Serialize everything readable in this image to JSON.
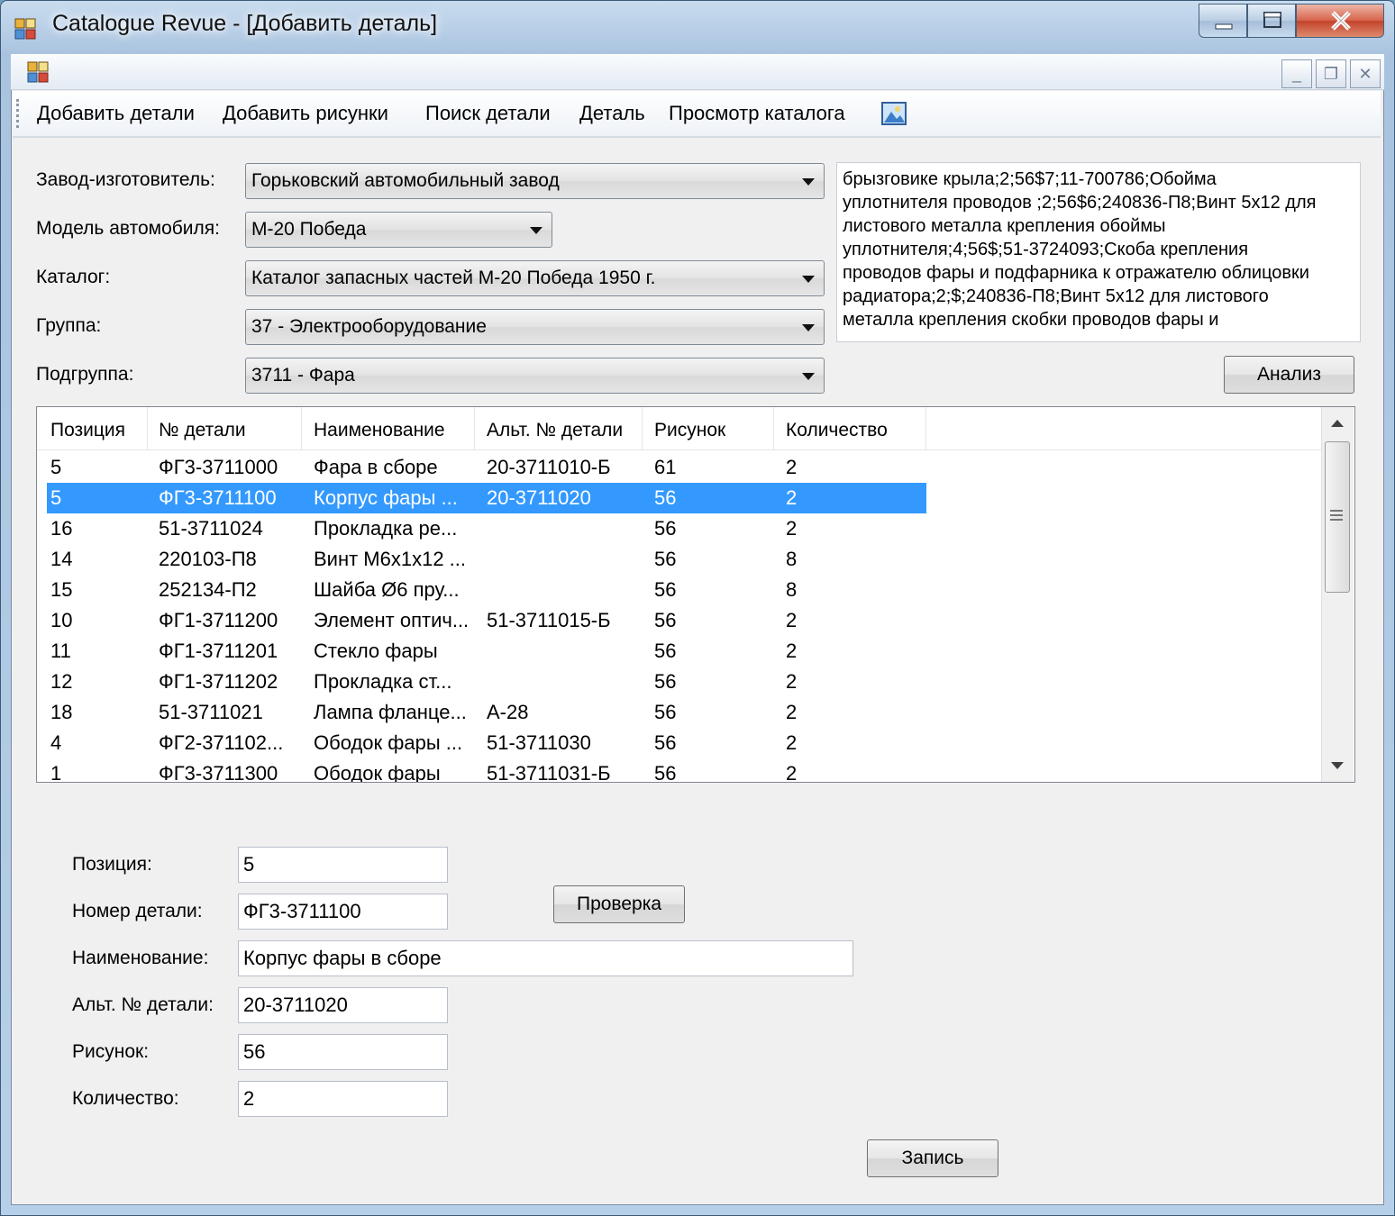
{
  "window": {
    "title": "Catalogue Revue - [Добавить деталь]"
  },
  "toolbar": {
    "items": [
      {
        "label": "Добавить детали"
      },
      {
        "label": "Добавить рисунки"
      },
      {
        "label": "Поиск детали"
      },
      {
        "label": "Деталь"
      },
      {
        "label": "Просмотр каталога"
      }
    ],
    "picture_icon": "picture-icon"
  },
  "filters": {
    "manufacturer": {
      "label": "Завод-изготовитель:",
      "value": "Горьковский автомобильный завод"
    },
    "model": {
      "label": "Модель автомобиля:",
      "value": "М-20 Победа"
    },
    "catalog": {
      "label": "Каталог:",
      "value": "Каталог запасных частей М-20 Победа 1950 г."
    },
    "group": {
      "label": "Группа:",
      "value": "37 - Электрооборудование"
    },
    "subgroup": {
      "label": "Подгруппа:",
      "value": "3711 - Фара"
    }
  },
  "memo": {
    "lines": [
      "брызговике крыла;2;56$7;11-700786;Обойма",
      "уплотнителя проводов ;2;56$6;240836-П8;Винт 5x12 для",
      "листового металла крепления обоймы",
      "уплотнителя;4;56$;51-3724093;Скоба крепления",
      "проводов фары и подфарника к отражателю облицовки",
      "радиатора;2;$;240836-П8;Винт 5x12 для листового",
      "металла крепления скобки проводов фары и"
    ]
  },
  "analyze_button": "Анализ",
  "table": {
    "columns": [
      "Позиция",
      "№ детали",
      "Наименование",
      "Альт. № детали",
      "Рисунок",
      "Количество"
    ],
    "rows": [
      {
        "pos": "5",
        "num": "ФГ3-3711000",
        "name": "Фара в сборе",
        "alt": "20-3711010-Б",
        "fig": "61",
        "qty": "2",
        "selected": false
      },
      {
        "pos": "5",
        "num": "ФГ3-3711100",
        "name": "Корпус фары ...",
        "alt": "20-3711020",
        "fig": "56",
        "qty": "2",
        "selected": true
      },
      {
        "pos": "16",
        "num": "51-3711024",
        "name": "Прокладка ре...",
        "alt": "",
        "fig": "56",
        "qty": "2",
        "selected": false
      },
      {
        "pos": "14",
        "num": "220103-П8",
        "name": "Винт М6х1х12 ...",
        "alt": "",
        "fig": "56",
        "qty": "8",
        "selected": false
      },
      {
        "pos": "15",
        "num": "252134-П2",
        "name": "Шайба Ø6 пру...",
        "alt": "",
        "fig": "56",
        "qty": "8",
        "selected": false
      },
      {
        "pos": "10",
        "num": "ФГ1-3711200",
        "name": "Элемент оптич...",
        "alt": "51-3711015-Б",
        "fig": "56",
        "qty": "2",
        "selected": false
      },
      {
        "pos": "11",
        "num": "ФГ1-3711201",
        "name": "Стекло фары",
        "alt": "",
        "fig": "56",
        "qty": "2",
        "selected": false
      },
      {
        "pos": "12",
        "num": "ФГ1-3711202",
        "name": "Прокладка ст...",
        "alt": "",
        "fig": "56",
        "qty": "2",
        "selected": false
      },
      {
        "pos": "18",
        "num": "51-3711021",
        "name": "Лампа фланце...",
        "alt": "А-28",
        "fig": "56",
        "qty": "2",
        "selected": false
      },
      {
        "pos": "4",
        "num": "ФГ2-371102...",
        "name": "Ободок фары ...",
        "alt": "51-3711030",
        "fig": "56",
        "qty": "2",
        "selected": false
      },
      {
        "pos": "1",
        "num": "ФГ3-3711300",
        "name": "Ободок фары",
        "alt": "51-3711031-Б",
        "fig": "56",
        "qty": "2",
        "selected": false
      }
    ]
  },
  "form": {
    "position": {
      "label": "Позиция:",
      "value": "5"
    },
    "part_number": {
      "label": "Номер детали:",
      "value": "ФГ3-3711100"
    },
    "name": {
      "label": "Наименование:",
      "value": "Корпус фары в сборе"
    },
    "alt_number": {
      "label": "Альт. № детали:",
      "value": "20-3711020"
    },
    "figure": {
      "label": "Рисунок:",
      "value": "56"
    },
    "quantity": {
      "label": "Количество:",
      "value": "2"
    }
  },
  "check_button": "Проверка",
  "save_button": "Запись",
  "colors": {
    "selection": "#3399ff",
    "form_bg": "#f0f0f0"
  }
}
